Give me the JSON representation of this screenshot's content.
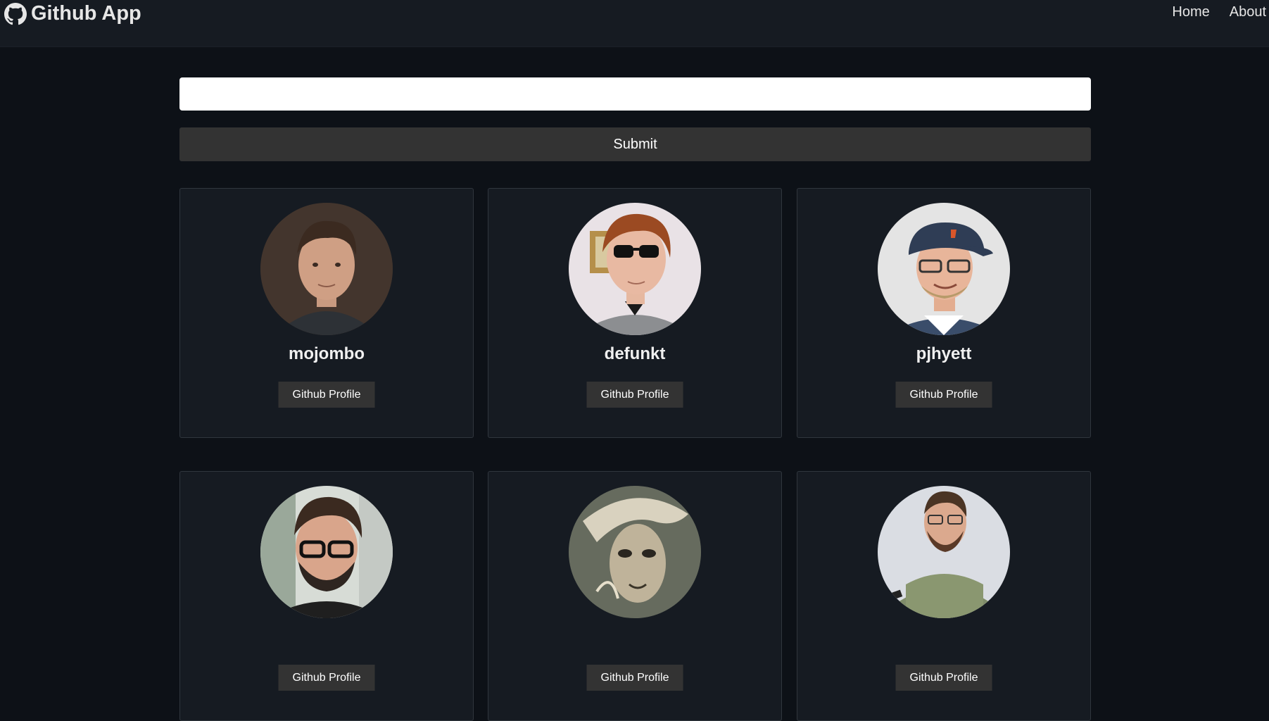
{
  "nav": {
    "brand": "Github App",
    "links": [
      "Home",
      "About"
    ]
  },
  "search": {
    "value": "",
    "placeholder": "",
    "submit_label": "Submit"
  },
  "users": [
    {
      "login": "mojombo",
      "button": "Github Profile"
    },
    {
      "login": "defunkt",
      "button": "Github Profile"
    },
    {
      "login": "pjhyett",
      "button": "Github Profile"
    },
    {
      "login": "",
      "button": "Github Profile"
    },
    {
      "login": "",
      "button": "Github Profile"
    },
    {
      "login": "",
      "button": "Github Profile"
    }
  ],
  "colors": {
    "page_bg": "#0d1117",
    "navbar_bg": "#161b22",
    "card_bg": "#161b22",
    "card_border": "#30363d",
    "button_bg": "#333333"
  },
  "icons": {
    "brand": "github-icon"
  }
}
